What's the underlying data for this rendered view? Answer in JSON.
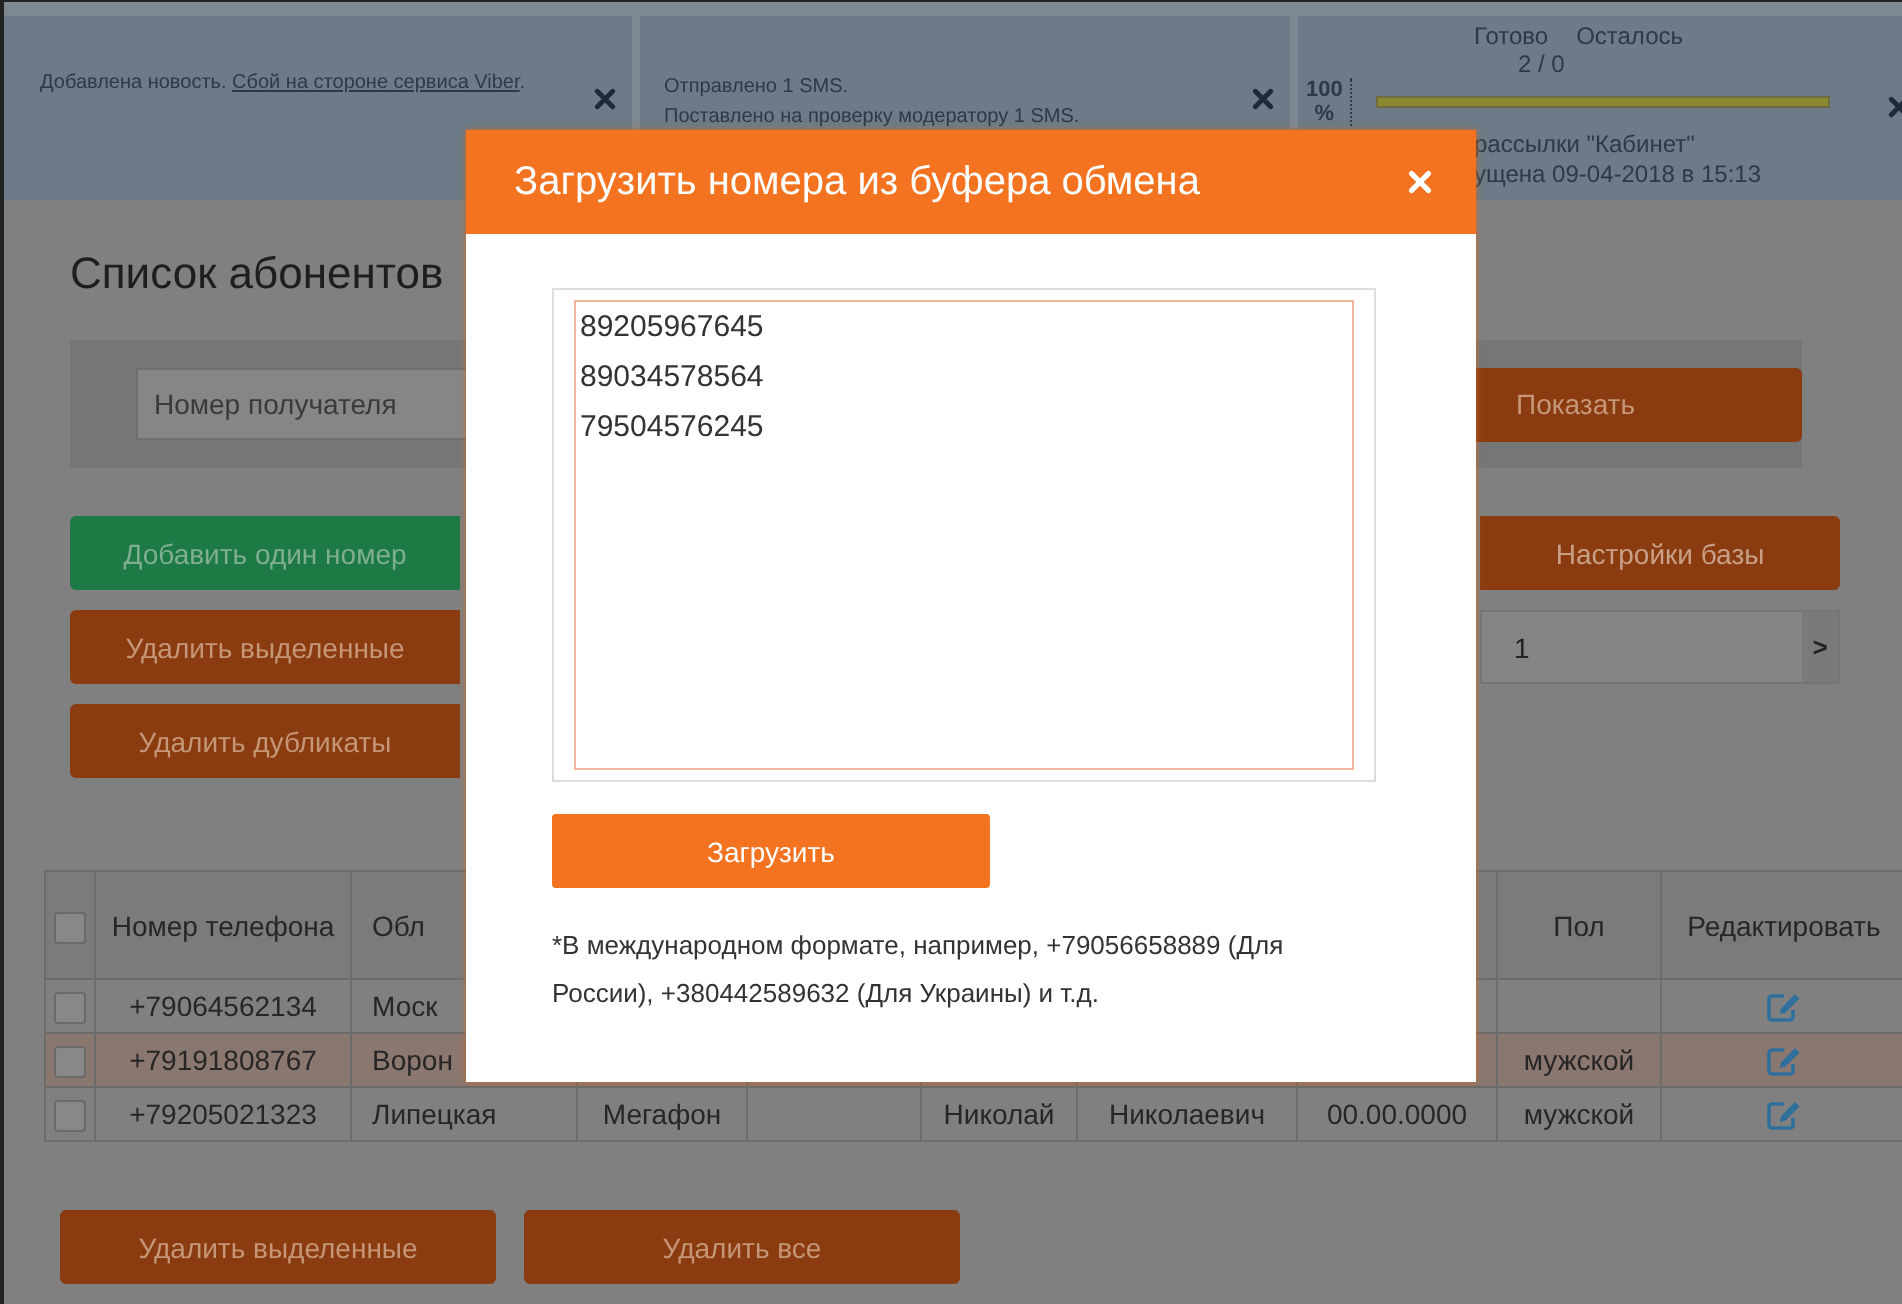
{
  "notifications": [
    {
      "kind": "message",
      "lines": [
        [
          {
            "kind": "text",
            "text": "Добавлена новость. "
          },
          {
            "kind": "link",
            "text": "Сбой на стороне сервиса Viber"
          },
          {
            "kind": "text",
            "text": "."
          }
        ]
      ]
    },
    {
      "kind": "message",
      "lines": [
        [
          {
            "kind": "text",
            "text": "Отправлено 1 SMS."
          }
        ],
        [
          {
            "kind": "text",
            "text": "Поставлено на проверку модератору 1 SMS."
          }
        ]
      ]
    },
    {
      "kind": "progress",
      "ready_label": "Готово",
      "left_label": "Осталось",
      "counts": "2 / 0",
      "percent": "100",
      "percent_sign": "%",
      "level": 1,
      "lines": [
        "рассылки \"Кабинет\"",
        "ущена 09-04-2018 в 15:13"
      ]
    }
  ],
  "page": {
    "title": "Список абонентов",
    "search": {
      "placeholder": "Номер получателя",
      "button": "Показать"
    },
    "left_buttons": [
      {
        "label": "Добавить один номер",
        "kind": "green"
      },
      {
        "label": "Удалить выделенные",
        "kind": "orange"
      },
      {
        "label": "Удалить дубликаты",
        "kind": "orange"
      }
    ],
    "settings_button": "Настройки базы",
    "pagination": {
      "page": "1",
      "next": ">"
    }
  },
  "table": {
    "header_checked": false,
    "columns": [
      {
        "kind": "text",
        "label": "Номер телефона"
      },
      {
        "kind": "text",
        "label": "Обл"
      },
      {
        "kind": "text"
      },
      {
        "kind": "text"
      },
      {
        "kind": "text"
      },
      {
        "kind": "text"
      },
      {
        "kind": "text"
      },
      {
        "kind": "text",
        "label": "Пол"
      },
      {
        "kind": "icon",
        "label": "Редактировать"
      }
    ],
    "rows": [
      {
        "checked": false,
        "highlighted": false,
        "cells": [
          "+79064562134",
          "Моск",
          null,
          null,
          null,
          null,
          null,
          null,
          null
        ]
      },
      {
        "checked": false,
        "highlighted": true,
        "cells": [
          "+79191808767",
          "Ворон",
          null,
          null,
          null,
          null,
          null,
          "мужской",
          null
        ]
      },
      {
        "checked": false,
        "highlighted": false,
        "cells": [
          "+79205021323",
          "Липецкая",
          "Мегафон",
          null,
          "Николай",
          "Николаевич",
          "00.00.0000",
          "мужской",
          null
        ]
      }
    ]
  },
  "bottom_buttons": [
    "Удалить выделенные",
    "Удалить все"
  ],
  "modal": {
    "title": "Загрузить номера из буфера обмена",
    "numbers": "89205967645\n89034578564\n79504576245",
    "button": "Загрузить",
    "note": "*В международном формате, например, +79056658889 (Для России), +380442589632 (Для Украины) и т.д."
  }
}
